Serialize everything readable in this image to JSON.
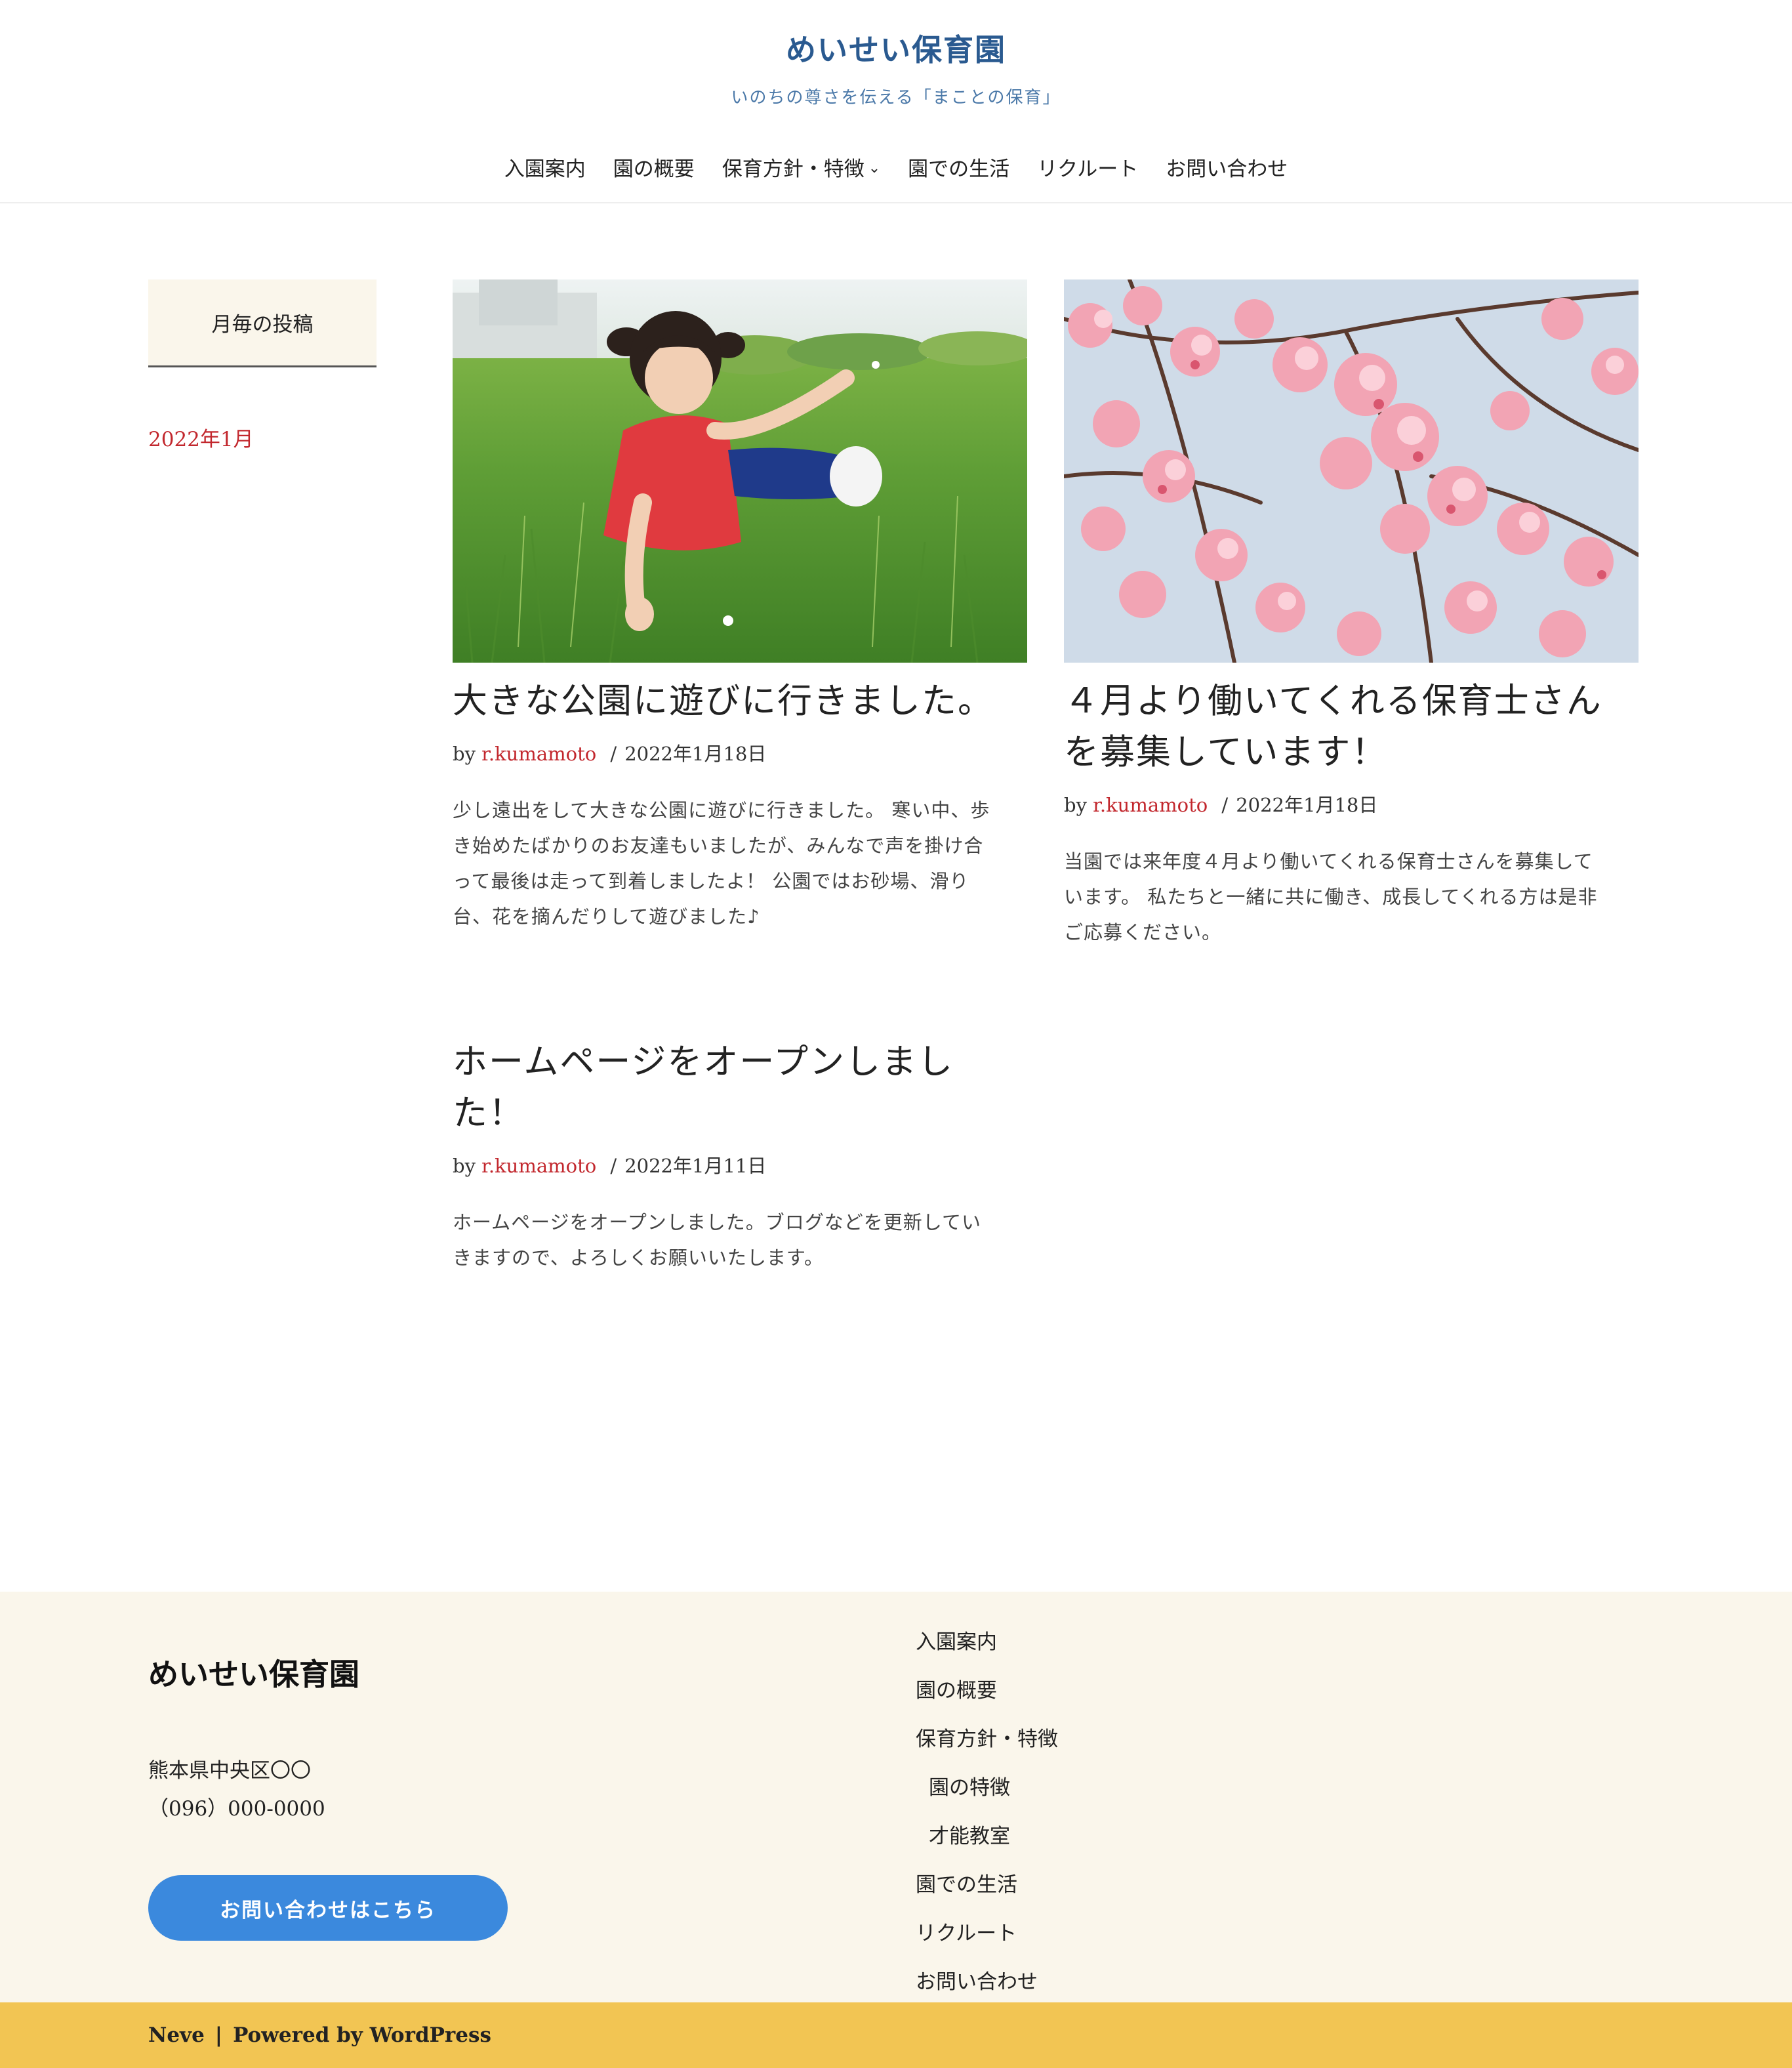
{
  "header": {
    "site_title": "めいせい保育園",
    "tagline": "いのちの尊さを伝える「まことの保育」",
    "nav": [
      {
        "label": "入園案内"
      },
      {
        "label": "園の概要"
      },
      {
        "label": "保育方針・特徴",
        "has_dropdown": true
      },
      {
        "label": "園での生活"
      },
      {
        "label": "リクルート"
      },
      {
        "label": "お問い合わせ"
      }
    ]
  },
  "sidebar": {
    "widget_title": "月毎の投稿",
    "archive_link": "2022年1月"
  },
  "posts": [
    {
      "title": "大きな公園に遊びに行きました。",
      "by": "by",
      "author": "r.kumamoto",
      "separator": "/",
      "date": "2022年1月18日",
      "excerpt_lines": [
        "少し遠出をして大きな公園に遊びに行きました。 寒い中、歩",
        "き始めたばかりのお友達もいましたが、みんなで声を掛け合",
        "って最後は走って到着しましたよ！ 公園ではお砂場、滑り",
        "台、花を摘んだりして遊びました♪"
      ],
      "image": "child-in-grass-photo"
    },
    {
      "title_lines": [
        "４月より働いてくれる保育士さん",
        "を募集しています！"
      ],
      "by": "by",
      "author": "r.kumamoto",
      "separator": "/",
      "date": "2022年1月18日",
      "excerpt_lines": [
        "当園では来年度４月より働いてくれる保育士さんを募集して",
        "います。 私たちと一緒に共に働き、成長してくれる方は是非",
        "ご応募ください。"
      ],
      "image": "cherry-blossom-photo"
    },
    {
      "title_lines": [
        "ホームページをオープンしまし",
        "た！"
      ],
      "by": "by",
      "author": "r.kumamoto",
      "separator": "/",
      "date": "2022年1月11日",
      "excerpt_lines": [
        "ホームページをオープンしました。ブログなどを更新してい",
        "きますので、よろしくお願いいたします。"
      ]
    }
  ],
  "footer": {
    "title": "めいせい保育園",
    "address": "熊本県中央区〇〇",
    "phone": "（096）000-0000",
    "contact_button": "お問い合わせはこちら",
    "nav": [
      {
        "label": "入園案内"
      },
      {
        "label": "園の概要"
      },
      {
        "label": "保育方針・特徴"
      },
      {
        "label": "園の特徴",
        "sub": true
      },
      {
        "label": "才能教室",
        "sub": true
      },
      {
        "label": "園での生活"
      },
      {
        "label": "リクルート"
      },
      {
        "label": "お問い合わせ"
      }
    ],
    "credit_theme": "Neve",
    "credit_bar": "|",
    "credit_powered": "Powered by WordPress"
  },
  "colors": {
    "site_title": "#2a5a90",
    "link_red": "#c2272d",
    "footer_bg": "#faf6eb",
    "button_blue": "#3b89dd",
    "bottom_bar": "#f2c553"
  }
}
